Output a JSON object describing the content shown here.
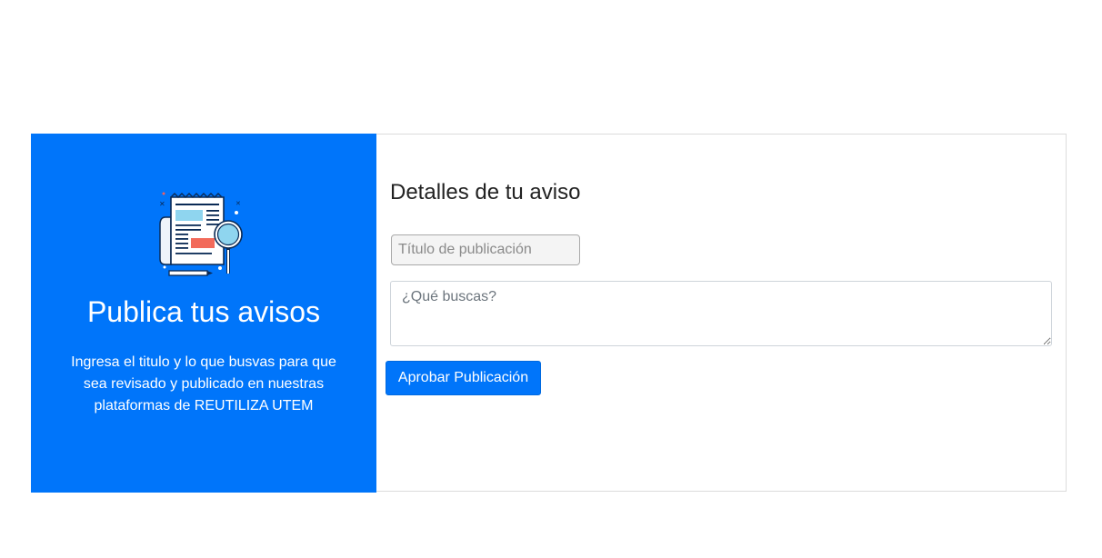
{
  "hero": {
    "icon": "newspaper-magnifier-icon",
    "title": "Publica tus avisos",
    "description": "Ingresa el titulo y lo que busvas para que sea revisado y publicado en nuestras plataformas de REUTILIZA UTEM"
  },
  "form": {
    "heading": "Detalles de tu aviso",
    "title_field": {
      "placeholder": "Título de publicación",
      "value": ""
    },
    "description_field": {
      "placeholder": "¿Qué buscas?",
      "value": ""
    },
    "submit_label": "Aprobar Publicación"
  },
  "colors": {
    "primary": "#0075fa",
    "card_border": "#dcdcdc"
  }
}
